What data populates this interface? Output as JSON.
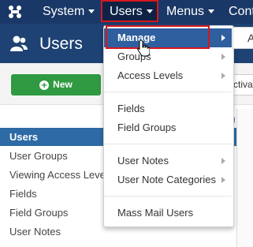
{
  "topbar": {
    "menus": [
      {
        "label": "System"
      },
      {
        "label": "Users"
      },
      {
        "label": "Menus"
      },
      {
        "label": "Cont"
      }
    ]
  },
  "header": {
    "title": "Users"
  },
  "toolbar": {
    "new_label": "New",
    "activate_label": "Activa"
  },
  "sidebar": {
    "items": [
      {
        "label": "Users",
        "active": true
      },
      {
        "label": "User Groups"
      },
      {
        "label": "Viewing Access Levels"
      },
      {
        "label": "Fields"
      },
      {
        "label": "Field Groups"
      },
      {
        "label": "User Notes"
      }
    ]
  },
  "users_dropdown": {
    "items": [
      {
        "label": "Manage",
        "highlighted": true,
        "has_submenu": true
      },
      {
        "label": "Groups",
        "has_submenu": true
      },
      {
        "label": "Access Levels",
        "has_submenu": true
      },
      {
        "label": "Fields"
      },
      {
        "label": "Field Groups"
      },
      {
        "label": "User Notes",
        "has_submenu": true
      },
      {
        "label": "User Note Categories",
        "has_submenu": true
      },
      {
        "label": "Mass Mail Users"
      }
    ]
  },
  "submenu_peek": {
    "label": "A"
  },
  "colors": {
    "topbar": "#1a3867",
    "header": "#1d4273",
    "highlight_box": "#d6171c",
    "new_button": "#2f9a41",
    "menu_highlight": "#2f5f9e",
    "sidebar_active": "#2e6aa5"
  }
}
